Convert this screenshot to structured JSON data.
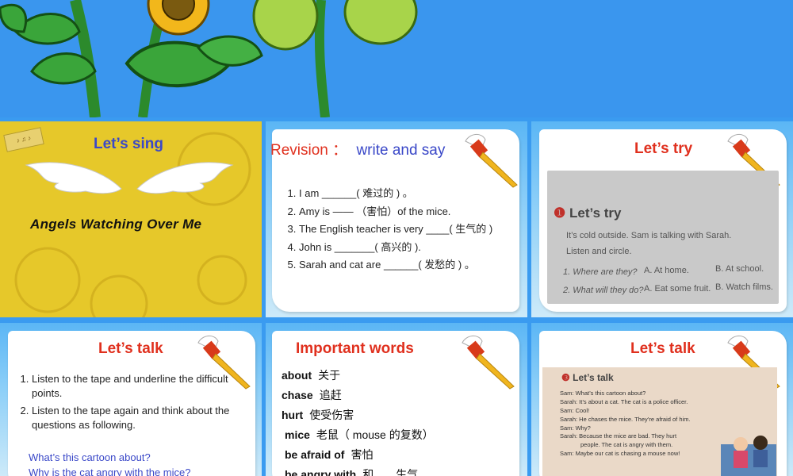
{
  "slide_sing": {
    "title": "Let’s sing",
    "song": "Angels Watching Over Me"
  },
  "slide_revision": {
    "title_a": "Revision ：",
    "title_b": "write and say",
    "items": [
      "I am ______( 难过的 ) 。",
      "Amy is —— （害怕）of the mice.",
      "The English teacher is very ____( 生气的 )",
      "John is _______( 高兴的 ).",
      "Sarah and cat are ______( 发愁的 ) 。"
    ]
  },
  "slide_try": {
    "title": "Let’s try",
    "book_heading": "Let’s try",
    "book_lines": [
      "It’s cold outside. Sam is talking with Sarah.",
      "Listen and circle."
    ],
    "q1": "1. Where are they?",
    "q1_a": "A. At home.",
    "q1_b": "B. At school.",
    "q2": "2. What will they do?",
    "q2_a": "A. Eat some fruit.",
    "q2_b": "B. Watch films."
  },
  "slide_talk": {
    "title": "Let’s talk",
    "items": [
      "Listen to the tape and underline the difficult points.",
      "Listen to the tape again and think about the questions as following."
    ],
    "questions": [
      "What’s this cartoon about?",
      "Why is the cat angry with the mice?"
    ]
  },
  "slide_words": {
    "title": "Important words",
    "words": [
      {
        "en": "about",
        "cn": "关于"
      },
      {
        "en": "chase",
        "cn": "追赶"
      },
      {
        "en": "hurt",
        "cn": "使受伤害"
      },
      {
        "en": "mice",
        "cn": "老鼠（ mouse 的复数）"
      },
      {
        "en": "be afraid of",
        "cn": "害怕"
      },
      {
        "en": "be angry with",
        "cn": "和……生气"
      }
    ]
  },
  "slide_talk2": {
    "title": "Let’s talk",
    "book_heading": "Let’s talk",
    "dialogue": [
      "Sam: What’s this cartoon about?",
      "Sarah: It’s about a cat. The cat is a police officer.",
      "Sam: Cool!",
      "Sarah: He chases the mice. They’re afraid of him.",
      "Sam: Why?",
      "Sarah: Because the mice are bad. They hurt",
      "people. The cat is angry with them.",
      "Sam: Maybe our cat is chasing a mouse now!"
    ]
  },
  "colors": {
    "title_red": "#e0301e",
    "title_blue": "#3a48c8",
    "sing_background": "#e6c82a",
    "banner_blue": "#3a96ee"
  }
}
